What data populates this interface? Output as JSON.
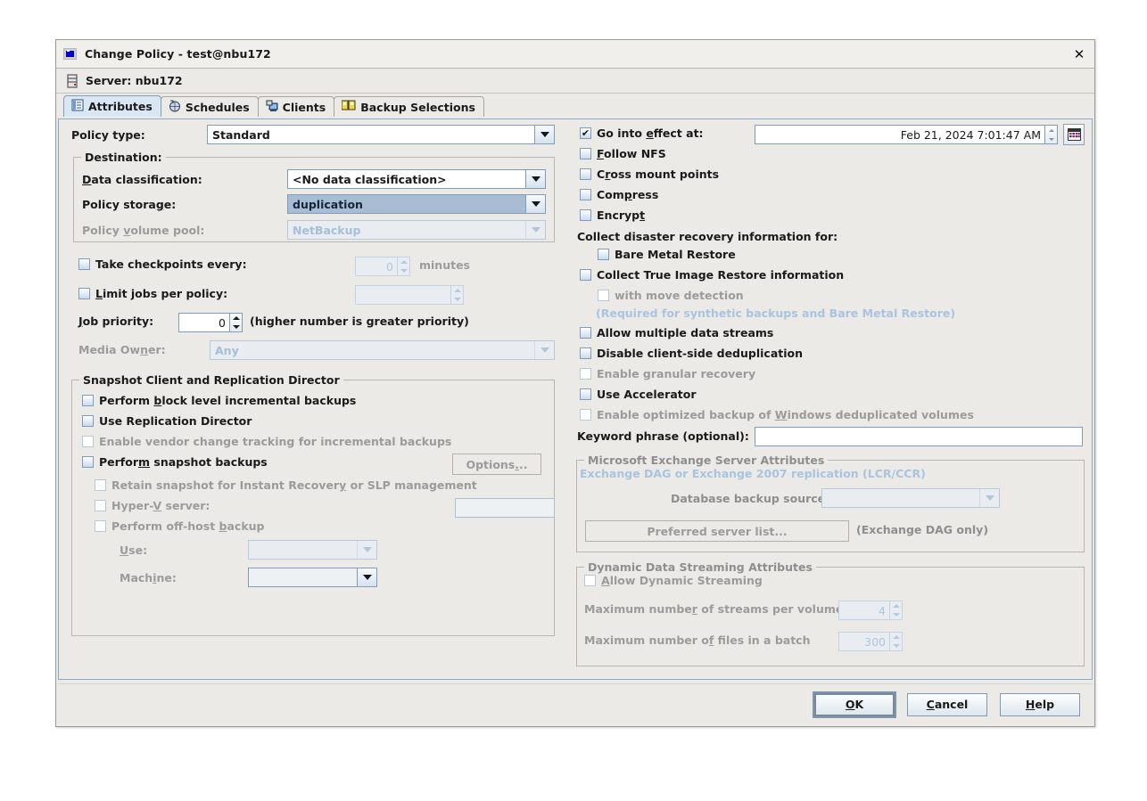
{
  "window": {
    "title": "Change Policy - test@nbu172",
    "title_icon": "policy-window-icon",
    "close_label": "✕",
    "server_icon": "server-icon",
    "server_label": "Server: nbu172"
  },
  "tabs": [
    {
      "label": "Attributes",
      "icon": "attributes-icon",
      "active": true
    },
    {
      "label": "Schedules",
      "icon": "schedules-icon",
      "active": false
    },
    {
      "label": "Clients",
      "icon": "clients-icon",
      "active": false
    },
    {
      "label": "Backup Selections",
      "icon": "backup-selections-icon",
      "active": false
    }
  ],
  "left": {
    "policy_type_label": "Policy type:",
    "policy_type_value": "Standard",
    "destination_group": "Destination:",
    "data_classification_label": "Data classification:",
    "data_classification_value": "<No data classification>",
    "policy_storage_label": "Policy storage:",
    "policy_storage_value": "duplication",
    "policy_volume_pool_label": "Policy volume pool:",
    "policy_volume_pool_value": "NetBackup",
    "take_checkpoints_label": "Take checkpoints every:",
    "take_checkpoints_value": "0",
    "minutes_label": "minutes",
    "limit_jobs_label": "Limit jobs per policy:",
    "limit_jobs_value": "",
    "job_priority_label": "Job priority:",
    "job_priority_value": "0",
    "job_priority_hint": "(higher number is greater priority)",
    "media_owner_label": "Media Owner:",
    "media_owner_value": "Any",
    "snapshot_group": "Snapshot Client and Replication Director",
    "perform_bli_label": "Perform block level incremental backups",
    "use_replication_director_label": "Use Replication Director",
    "enable_vendor_change_label": "Enable vendor change tracking for incremental backups",
    "perform_snapshot_label": "Perform snapshot backups",
    "options_button": "Options...",
    "retain_snapshot_label": "Retain snapshot for Instant Recovery or SLP management",
    "hyperv_label": "Hyper-V server:",
    "hyperv_value": "",
    "perform_offhost_label": "Perform off-host backup",
    "use_label": "Use:",
    "use_value": "",
    "machine_label": "Machine:",
    "machine_value": ""
  },
  "right": {
    "go_into_effect_label": "Go into effect at:",
    "go_into_effect_value": "Feb 21, 2024 7:01:47 AM",
    "calendar_icon": "calendar-icon",
    "follow_nfs_label": "Follow NFS",
    "cross_mount_label": "Cross mount points",
    "compress_label": "Compress",
    "encrypt_label": "Encrypt",
    "collect_dr_label": "Collect disaster recovery information for:",
    "bare_metal_label": "Bare Metal Restore",
    "collect_tir_label": "Collect True Image Restore information",
    "with_move_detection_label": "with move detection",
    "required_note": "(Required for synthetic backups and Bare Metal Restore)",
    "allow_multiple_streams_label": "Allow multiple data streams",
    "disable_client_dedup_label": "Disable client-side deduplication",
    "enable_granular_label": "Enable granular recovery",
    "use_accelerator_label": "Use Accelerator",
    "enable_optimized_label": "Enable optimized backup of Windows deduplicated volumes",
    "keyword_phrase_label": "Keyword phrase (optional):",
    "keyword_phrase_value": "",
    "exchange_group": "Microsoft Exchange Server Attributes",
    "exchange_dag_label": "Exchange DAG or Exchange 2007 replication (LCR/CCR)",
    "database_backup_source_label": "Database backup source:",
    "database_backup_source_value": "",
    "preferred_server_button": "Preferred server list...",
    "exchange_dag_only_note": "(Exchange DAG only)",
    "dds_group": "Dynamic Data Streaming Attributes",
    "allow_dynamic_streaming_label": "Allow Dynamic Streaming",
    "max_streams_label": "Maximum number of streams per volume",
    "max_streams_value": "4",
    "max_files_label": "Maximum number of files in a batch",
    "max_files_value": "300"
  },
  "buttons": {
    "ok": "OK",
    "cancel": "Cancel",
    "help": "Help"
  },
  "colors": {
    "accent_selected": "#a8bdd4",
    "disabled_blue_text": "#a8c4e0",
    "tab_active_bg": "#d9e7f5",
    "window_bg": "#eceae6"
  }
}
